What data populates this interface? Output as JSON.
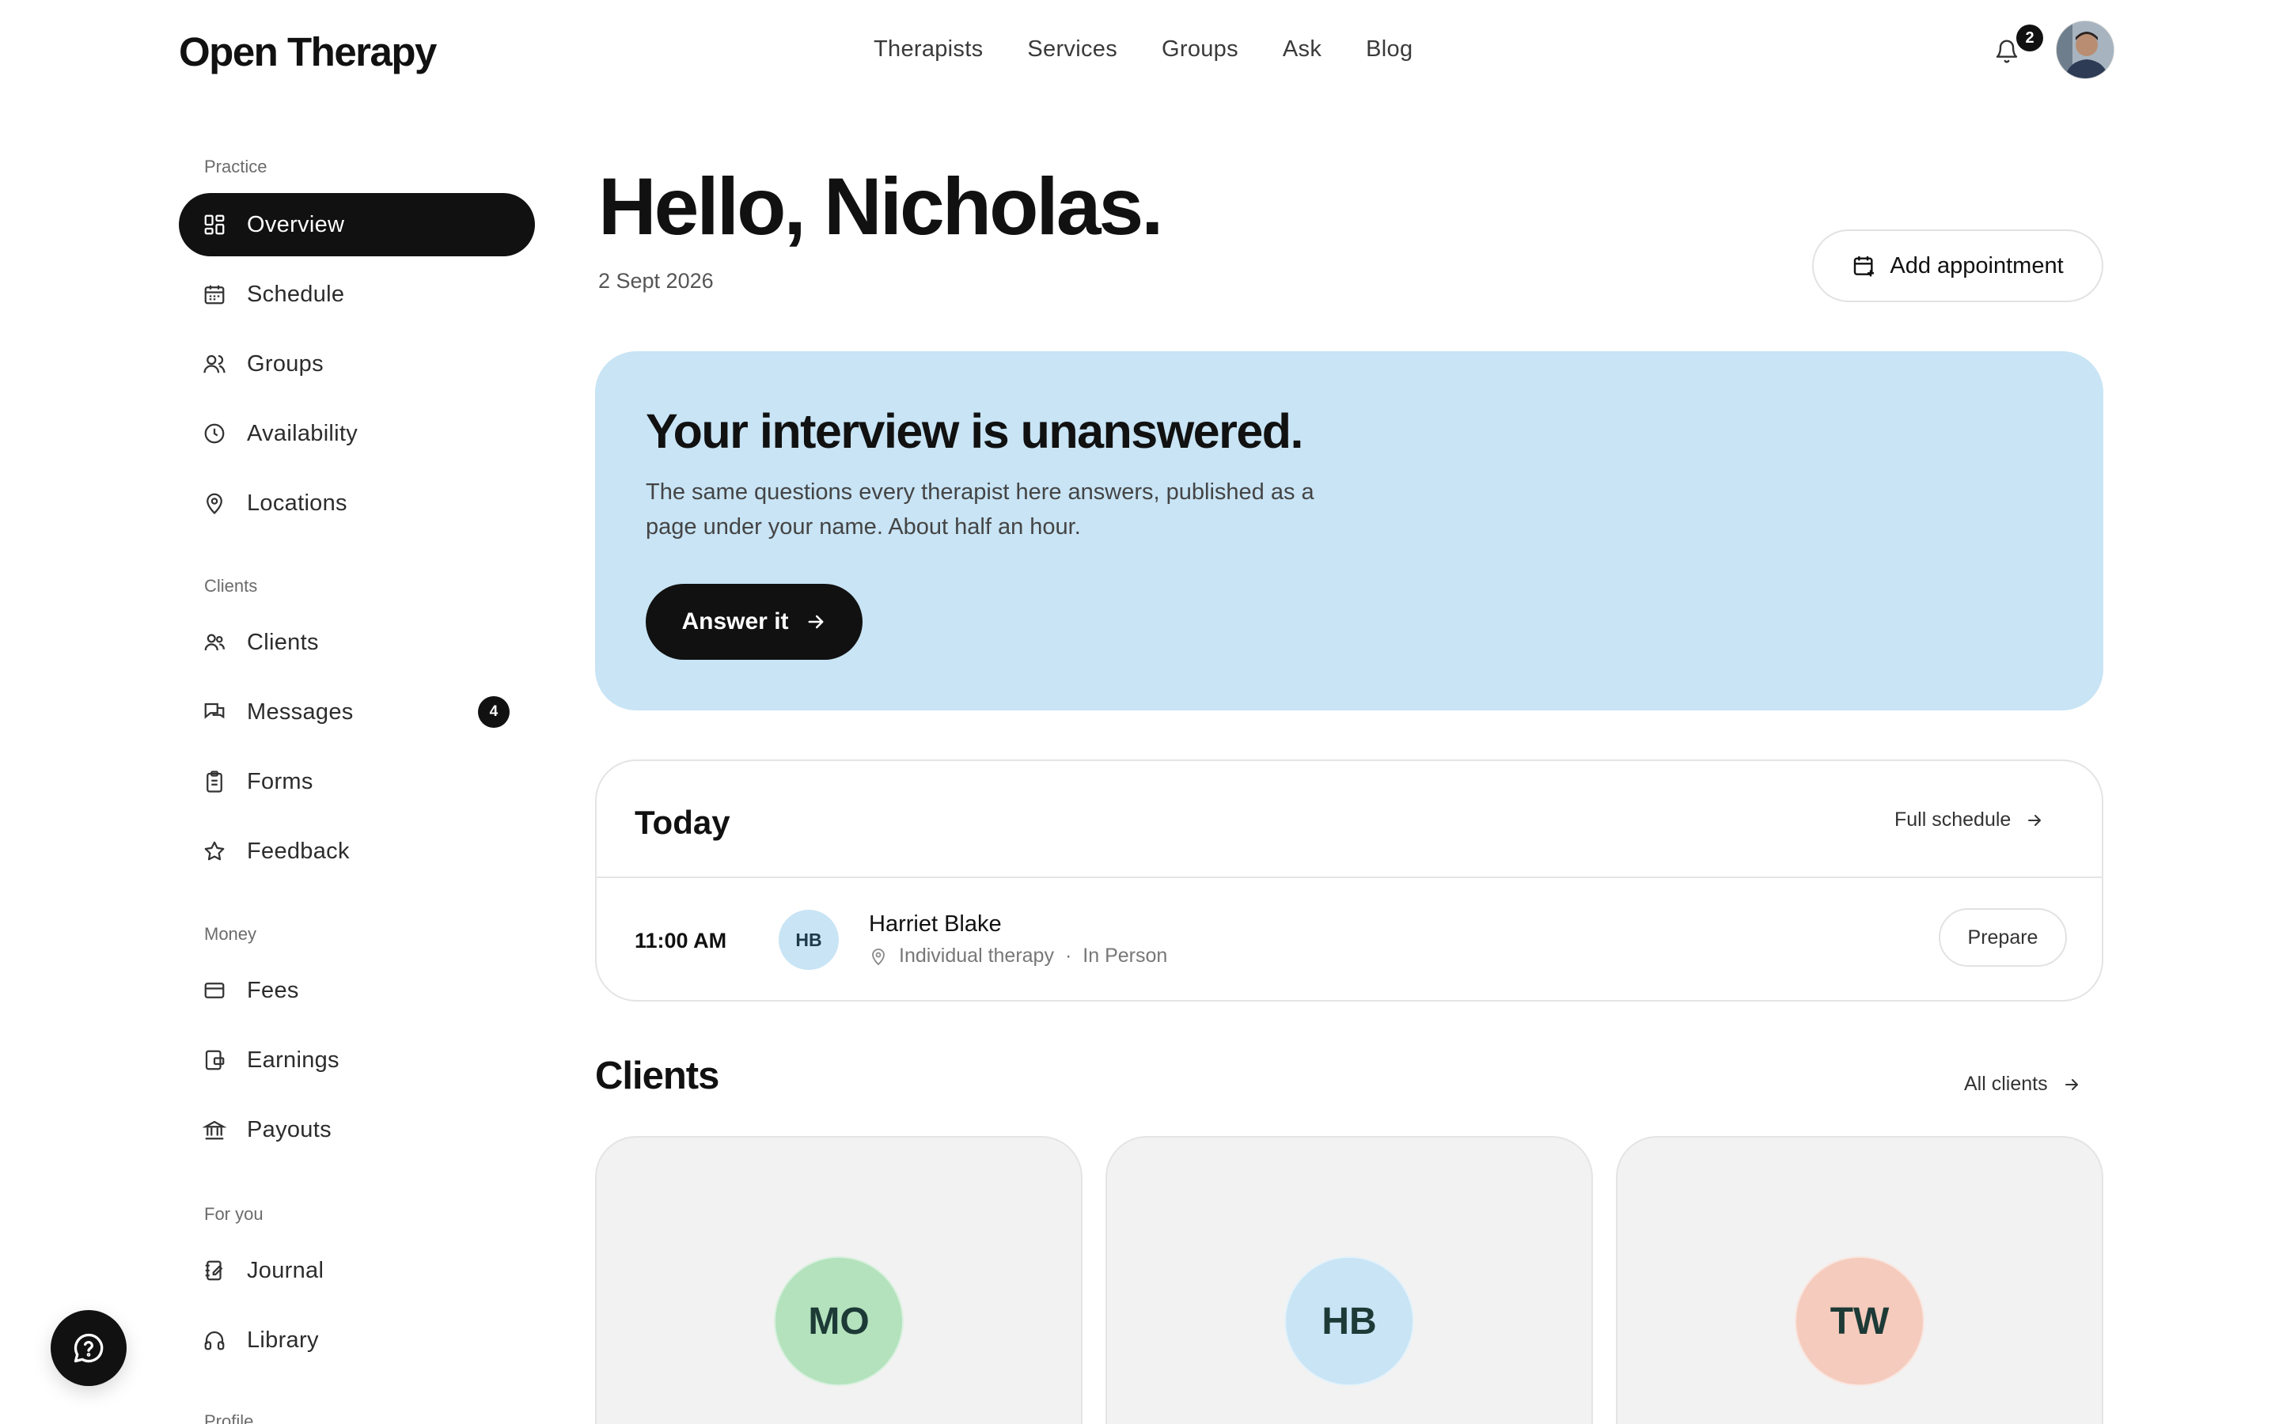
{
  "header": {
    "brand": "Open Therapy",
    "nav": [
      "Therapists",
      "Services",
      "Groups",
      "Ask",
      "Blog"
    ],
    "notifications_count": "2"
  },
  "sidebar": {
    "sections": [
      {
        "label": "Practice",
        "items": [
          {
            "label": "Overview",
            "icon": "grid-icon",
            "active": true
          },
          {
            "label": "Schedule",
            "icon": "calendar-icon"
          },
          {
            "label": "Groups",
            "icon": "users-icon"
          },
          {
            "label": "Availability",
            "icon": "clock-icon"
          },
          {
            "label": "Locations",
            "icon": "map-pin-icon"
          }
        ]
      },
      {
        "label": "Clients",
        "items": [
          {
            "label": "Clients",
            "icon": "people-icon"
          },
          {
            "label": "Messages",
            "icon": "chat-icon",
            "count": "4"
          },
          {
            "label": "Forms",
            "icon": "clipboard-icon"
          },
          {
            "label": "Feedback",
            "icon": "star-icon"
          }
        ]
      },
      {
        "label": "Money",
        "items": [
          {
            "label": "Fees",
            "icon": "credit-card-icon"
          },
          {
            "label": "Earnings",
            "icon": "wallet-icon"
          },
          {
            "label": "Payouts",
            "icon": "bank-icon"
          }
        ]
      },
      {
        "label": "For you",
        "items": [
          {
            "label": "Journal",
            "icon": "notebook-icon"
          },
          {
            "label": "Library",
            "icon": "headphones-icon"
          }
        ]
      },
      {
        "label": "Profile",
        "items": []
      }
    ]
  },
  "main": {
    "greeting": "Hello, Nicholas.",
    "date": "2 Sept 2026",
    "add_appointment_label": "Add appointment",
    "banner": {
      "title": "Your interview is unanswered.",
      "body": "The same questions every therapist here answers, published as a page under your name. About half an hour.",
      "cta_label": "Answer it",
      "bg_color": "#c8e4f5"
    },
    "today": {
      "title": "Today",
      "full_schedule_label": "Full schedule",
      "appointments": [
        {
          "time": "11:00 AM",
          "initials": "HB",
          "name": "Harriet Blake",
          "type": "Individual therapy",
          "mode": "In Person",
          "action": "Prepare"
        }
      ]
    },
    "clients": {
      "title": "Clients",
      "all_clients_label": "All clients",
      "cards": [
        {
          "initials": "MO",
          "color": "#b3e2bd"
        },
        {
          "initials": "HB",
          "color": "#c8e4f5"
        },
        {
          "initials": "TW",
          "color": "#f4cbbd"
        }
      ]
    }
  }
}
